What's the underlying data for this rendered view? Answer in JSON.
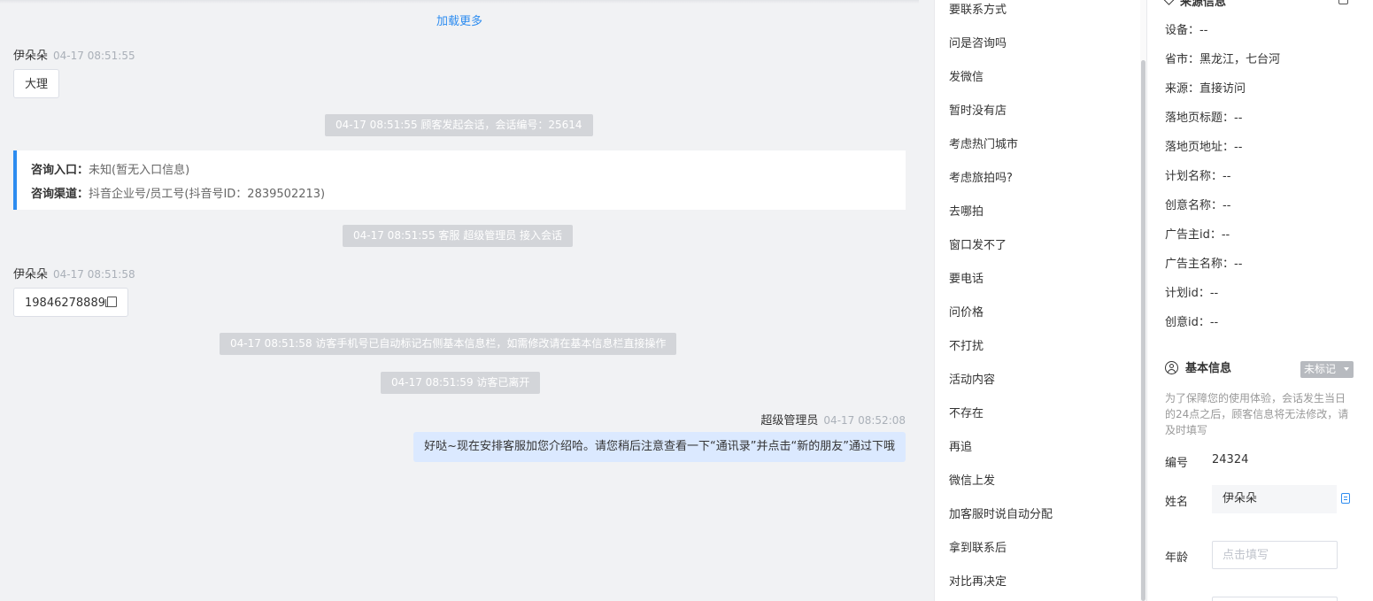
{
  "chat": {
    "load_more": "加载更多",
    "msg1": {
      "sender": "伊朵朵",
      "time": "04-17 08:51:55",
      "text": "大理"
    },
    "sys_session_start": "04-17 08:51:55 顾客发起会话，会话编号：25614",
    "info_card": {
      "entry_label": "咨询入口：",
      "entry_value": "未知(暂无入口信息)",
      "channel_label": "咨询渠道：",
      "channel_value": "抖音企业号/员工号(抖音号ID：2839502213)"
    },
    "sys_agent_join": "04-17 08:51:55 客服 超级管理员 接入会话",
    "msg2": {
      "sender": "伊朵朵",
      "time": "04-17 08:51:58",
      "text": "19846278889"
    },
    "sys_auto_mark": "04-17 08:51:58 访客手机号已自动标记右侧基本信息栏，如需修改请在基本信息栏直接操作",
    "sys_left": "04-17 08:51:59 访客已离开",
    "agent_msg": {
      "sender": "超级管理员",
      "time": "04-17 08:52:08",
      "text": "好哒~现在安排客服加您介绍哈。请您稍后注意查看一下“通讯录”并点击“新的朋友”通过下哦"
    }
  },
  "quick_replies": [
    "要联系方式",
    "问是咨询吗",
    "发微信",
    "暂时没有店",
    "考虑热门城市",
    "考虑旅拍吗?",
    "去哪拍",
    "窗口发不了",
    "要电话",
    "问价格",
    "不打扰",
    "活动内容",
    "不存在",
    "再追",
    "微信上发",
    "加客服时说自动分配",
    "拿到联系后",
    "对比再决定"
  ],
  "source_info": {
    "title": "来源信息",
    "fields": [
      "设备：--",
      "省市：黑龙江，七台河",
      "来源：直接访问",
      "落地页标题：--",
      "落地页地址：--",
      "计划名称：--",
      "创意名称：--",
      "广告主id：--",
      "广告主名称：--",
      "计划id：--",
      "创意id：--"
    ]
  },
  "basic_info": {
    "title": "基本信息",
    "mark_label": "未标记",
    "notice": "为了保障您的使用体验，会话发生当日的24点之后，顾客信息将无法修改，请及时填写",
    "id_label": "编号",
    "id_value": "24324",
    "name_label": "姓名",
    "name_value": "伊朵朵",
    "age_label": "年龄",
    "age_placeholder": "点击填写"
  },
  "colors": {
    "accent": "#2d8cf0",
    "agent_bubble": "#dbe9ff",
    "system_msg": "#d3d5d9"
  }
}
